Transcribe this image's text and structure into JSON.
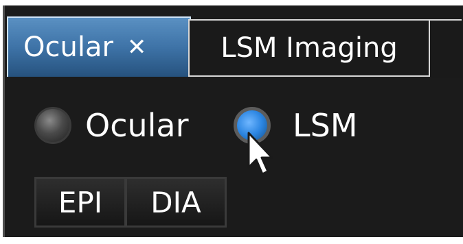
{
  "tabs": [
    {
      "label": "Ocular",
      "close_symbol": "✕",
      "active": true
    },
    {
      "label": "LSM Imaging",
      "active": false
    }
  ],
  "radio_options": [
    {
      "label": "Ocular",
      "selected": false
    },
    {
      "label": "LSM",
      "selected": true
    }
  ],
  "buttons": [
    {
      "label": "EPI"
    },
    {
      "label": "DIA"
    }
  ],
  "colors": {
    "active_tab": "#3e73a7",
    "panel_background": "#1b1b1b",
    "selected_radio": "#2c86e2"
  },
  "icons": {
    "cursor": "mouse-pointer-icon",
    "tab_close": "close-icon"
  }
}
